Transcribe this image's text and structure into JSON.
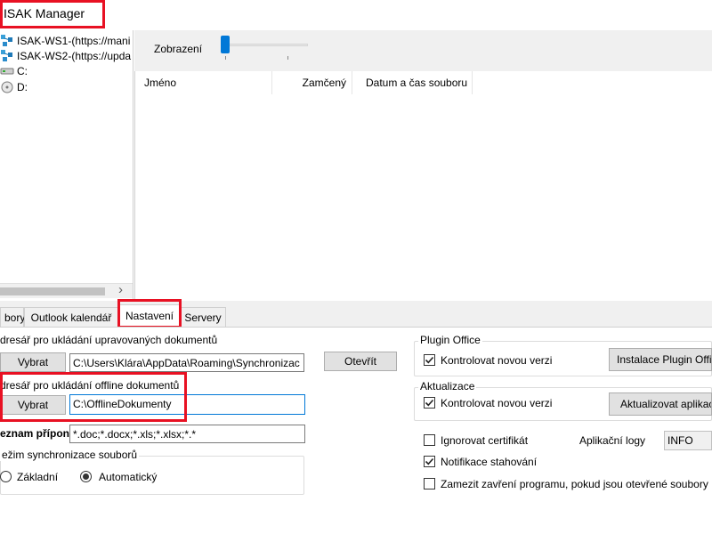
{
  "window": {
    "title": "ISAK Manager"
  },
  "tree": {
    "items": [
      {
        "label": "ISAK-WS1-(https://mani",
        "icon": "server-icon"
      },
      {
        "label": "ISAK-WS2-(https://upda",
        "icon": "server-icon"
      },
      {
        "label": "C:",
        "icon": "drive-icon"
      },
      {
        "label": "D:",
        "icon": "disc-drive-icon"
      }
    ],
    "scroll_right_glyph": "›"
  },
  "view": {
    "zoom_label": "Zobrazení"
  },
  "file_table": {
    "columns": [
      "Jméno",
      "Zamčený",
      "Datum a čas souboru"
    ]
  },
  "tabs": [
    {
      "label": "bory"
    },
    {
      "label": "Outlook kalendář"
    },
    {
      "label": "Nastavení",
      "active": true
    },
    {
      "label": "Servery"
    }
  ],
  "settings": {
    "edited_dir": {
      "label": "dresář pro ukládání upravovaných dokumentů",
      "select_button": "Vybrat",
      "path": "C:\\Users\\Klára\\AppData\\Roaming\\Synchronizac",
      "open_button": "Otevřít"
    },
    "offline_dir": {
      "label": "dresář pro ukládání offline dokumentů",
      "select_button": "Vybrat",
      "path": "C:\\OfflineDokumenty"
    },
    "extensions": {
      "label": "eznam přípon",
      "value": "*.doc;*.docx;*.xls;*.xlsx;*.*"
    },
    "sync_mode": {
      "label": "ežim synchronizace souborů",
      "options": [
        "Základní",
        "Automatický"
      ],
      "selected": "Automatický"
    },
    "plugin_office": {
      "label": "Plugin Office",
      "check_label": "Kontrolovat novou verzi",
      "checked": true,
      "button": "Instalace Plugin Office"
    },
    "updates": {
      "label": "Aktualizace",
      "check_label": "Kontrolovat novou verzi",
      "checked": true,
      "button": "Aktualizovat aplikaci"
    },
    "ignore_cert": {
      "label": "Ignorovat certifikát",
      "checked": false
    },
    "app_logs": {
      "label": "Aplikační logy",
      "value": "INFO"
    },
    "download_notify": {
      "label": "Notifikace stahování",
      "checked": true
    },
    "prevent_close": {
      "label": "Zamezit zavření programu, pokud jsou otevřené soubory",
      "checked": false
    }
  },
  "colors": {
    "highlight": "#e81123",
    "focus_border": "#0078d7",
    "slider_thumb": "#0078d7",
    "panel_bg": "#f0f0f0"
  }
}
